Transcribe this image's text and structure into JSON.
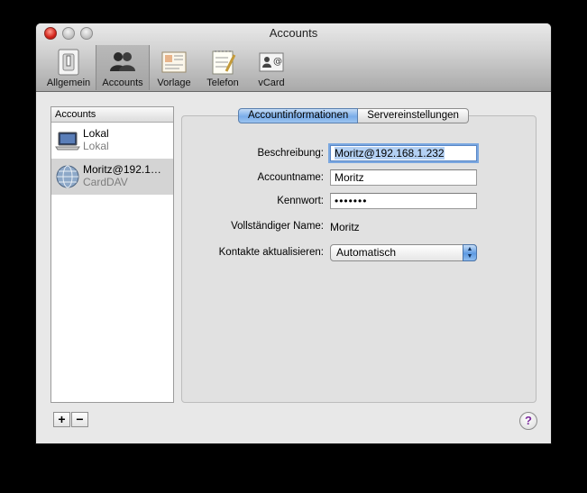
{
  "window": {
    "title": "Accounts"
  },
  "toolbar": {
    "items": [
      {
        "label": "Allgemein",
        "icon": "general-switch-icon"
      },
      {
        "label": "Accounts",
        "icon": "accounts-people-icon",
        "selected": true
      },
      {
        "label": "Vorlage",
        "icon": "template-card-icon"
      },
      {
        "label": "Telefon",
        "icon": "phone-notepad-icon"
      },
      {
        "label": "vCard",
        "icon": "vcard-icon"
      }
    ]
  },
  "sidebar": {
    "header": "Accounts",
    "accounts": [
      {
        "name": "Lokal",
        "type": "Lokal",
        "icon": "laptop-icon"
      },
      {
        "name": "Moritz@192.1…",
        "type": "CardDAV",
        "icon": "network-globe-icon",
        "selected": true
      }
    ],
    "add_label": "+",
    "remove_label": "−"
  },
  "tabs": {
    "account_info": "Accountinformationen",
    "server_settings": "Servereinstellungen"
  },
  "form": {
    "description_label": "Beschreibung:",
    "description_value": "Moritz@192.168.1.232",
    "account_name_label": "Accountname:",
    "account_name_value": "Moritz",
    "password_label": "Kennwort:",
    "password_value": "•••••••",
    "full_name_label": "Vollständiger Name:",
    "full_name_value": "Moritz",
    "update_label": "Kontakte aktualisieren:",
    "update_value": "Automatisch"
  },
  "help": {
    "label": "?"
  },
  "colors": {
    "accent": "#7aadea",
    "selection": "#d4d4d4"
  }
}
